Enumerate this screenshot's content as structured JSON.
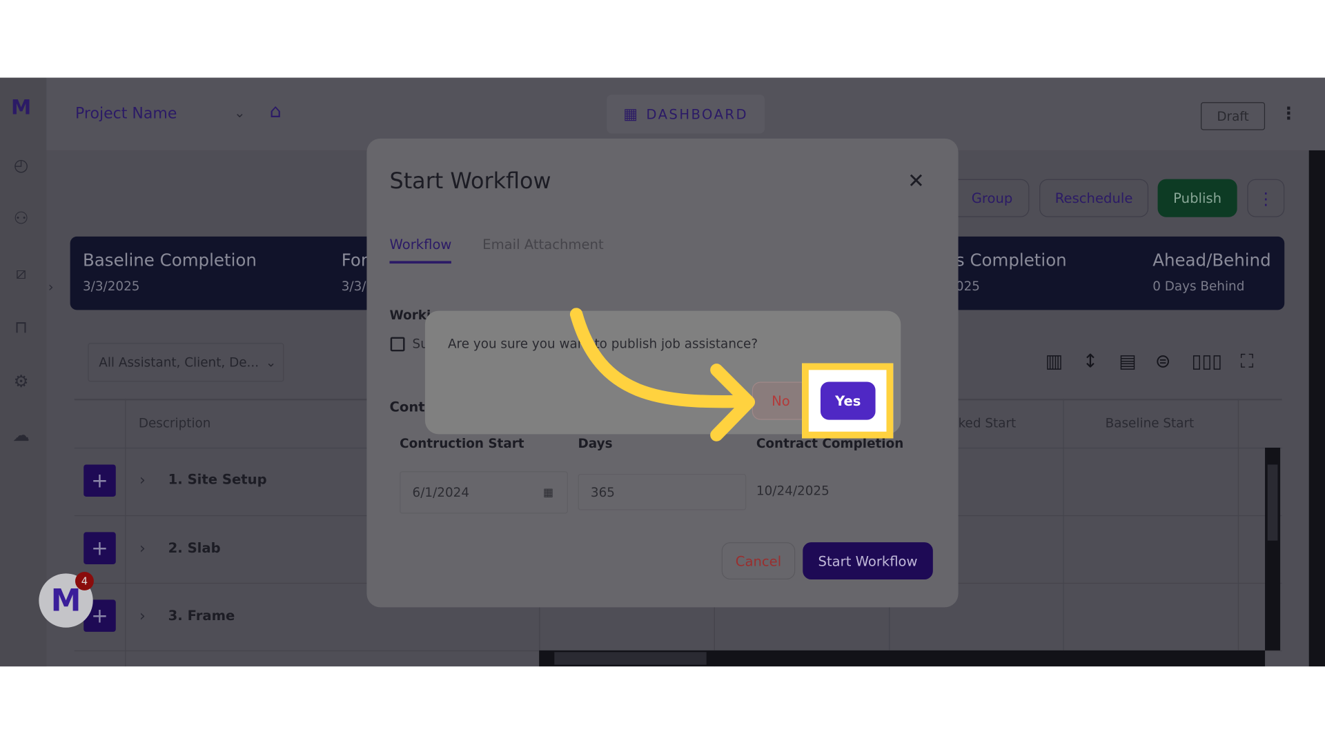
{
  "header": {
    "project_name": "Project Name",
    "dashboard_label": "DASHBOARD",
    "draft_label": "Draft"
  },
  "sidebar": {
    "icons": [
      "speedometer-icon",
      "users-icon",
      "chart-icon",
      "presentation-icon",
      "gear-icon",
      "cloud-network-icon"
    ]
  },
  "actions": {
    "group_label": "Group",
    "reschedule_label": "Reschedule",
    "publish_label": "Publish"
  },
  "banner": {
    "baseline_title": "Baseline Completion",
    "baseline_value": "3/3/2025",
    "forecast_title": "For",
    "forecast_value": "3/3/",
    "status_title": "s Completion",
    "status_value": "025",
    "ahead_title": "Ahead/Behind",
    "ahead_value": "0 Days Behind"
  },
  "filter": {
    "value": "All Assistant, Client, De..."
  },
  "table": {
    "headers": [
      "Description",
      "ked Start",
      "Baseline Start"
    ],
    "rows": [
      {
        "label": "1. Site Setup"
      },
      {
        "label": "2. Slab"
      },
      {
        "label": "3. Frame"
      }
    ]
  },
  "modal": {
    "title": "Start Workflow",
    "tabs": [
      {
        "label": "Workflow",
        "active": true
      },
      {
        "label": "Email Attachment",
        "active": false
      }
    ],
    "working_label": "Worki",
    "checkbox_label": "Su",
    "contract_label": "Contr",
    "construction_start_label": "Contruction Start",
    "days_label": "Days",
    "contract_completion_label": "Contract Completion",
    "construction_start_value": "6/1/2024",
    "days_value": "365",
    "contract_completion_value": "10/24/2025",
    "cancel_label": "Cancel",
    "start_label": "Start Workflow"
  },
  "confirm": {
    "message": "Are you sure you want to publish job assistance?",
    "no_label": "No",
    "yes_label": "Yes"
  },
  "notification": {
    "count": "4"
  },
  "colors": {
    "accent": "#4f28c4",
    "highlight": "#ffd23f",
    "publish": "#0d3b24",
    "danger": "#b33a3a"
  }
}
